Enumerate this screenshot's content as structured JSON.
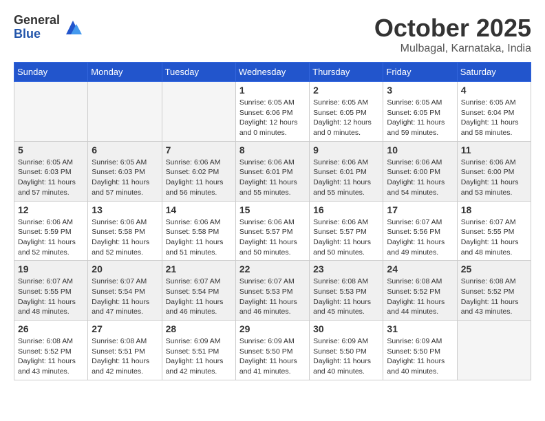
{
  "logo": {
    "general": "General",
    "blue": "Blue"
  },
  "header": {
    "month": "October 2025",
    "location": "Mulbagal, Karnataka, India"
  },
  "weekdays": [
    "Sunday",
    "Monday",
    "Tuesday",
    "Wednesday",
    "Thursday",
    "Friday",
    "Saturday"
  ],
  "weeks": [
    {
      "shaded": false,
      "days": [
        {
          "num": "",
          "empty": true
        },
        {
          "num": "",
          "empty": true
        },
        {
          "num": "",
          "empty": true
        },
        {
          "num": "1",
          "sunrise": "6:05 AM",
          "sunset": "6:06 PM",
          "daylight": "12 hours and 0 minutes."
        },
        {
          "num": "2",
          "sunrise": "6:05 AM",
          "sunset": "6:05 PM",
          "daylight": "12 hours and 0 minutes."
        },
        {
          "num": "3",
          "sunrise": "6:05 AM",
          "sunset": "6:05 PM",
          "daylight": "11 hours and 59 minutes."
        },
        {
          "num": "4",
          "sunrise": "6:05 AM",
          "sunset": "6:04 PM",
          "daylight": "11 hours and 58 minutes."
        }
      ]
    },
    {
      "shaded": true,
      "days": [
        {
          "num": "5",
          "sunrise": "6:05 AM",
          "sunset": "6:03 PM",
          "daylight": "11 hours and 57 minutes."
        },
        {
          "num": "6",
          "sunrise": "6:05 AM",
          "sunset": "6:03 PM",
          "daylight": "11 hours and 57 minutes."
        },
        {
          "num": "7",
          "sunrise": "6:06 AM",
          "sunset": "6:02 PM",
          "daylight": "11 hours and 56 minutes."
        },
        {
          "num": "8",
          "sunrise": "6:06 AM",
          "sunset": "6:01 PM",
          "daylight": "11 hours and 55 minutes."
        },
        {
          "num": "9",
          "sunrise": "6:06 AM",
          "sunset": "6:01 PM",
          "daylight": "11 hours and 55 minutes."
        },
        {
          "num": "10",
          "sunrise": "6:06 AM",
          "sunset": "6:00 PM",
          "daylight": "11 hours and 54 minutes."
        },
        {
          "num": "11",
          "sunrise": "6:06 AM",
          "sunset": "6:00 PM",
          "daylight": "11 hours and 53 minutes."
        }
      ]
    },
    {
      "shaded": false,
      "days": [
        {
          "num": "12",
          "sunrise": "6:06 AM",
          "sunset": "5:59 PM",
          "daylight": "11 hours and 52 minutes."
        },
        {
          "num": "13",
          "sunrise": "6:06 AM",
          "sunset": "5:58 PM",
          "daylight": "11 hours and 52 minutes."
        },
        {
          "num": "14",
          "sunrise": "6:06 AM",
          "sunset": "5:58 PM",
          "daylight": "11 hours and 51 minutes."
        },
        {
          "num": "15",
          "sunrise": "6:06 AM",
          "sunset": "5:57 PM",
          "daylight": "11 hours and 50 minutes."
        },
        {
          "num": "16",
          "sunrise": "6:06 AM",
          "sunset": "5:57 PM",
          "daylight": "11 hours and 50 minutes."
        },
        {
          "num": "17",
          "sunrise": "6:07 AM",
          "sunset": "5:56 PM",
          "daylight": "11 hours and 49 minutes."
        },
        {
          "num": "18",
          "sunrise": "6:07 AM",
          "sunset": "5:55 PM",
          "daylight": "11 hours and 48 minutes."
        }
      ]
    },
    {
      "shaded": true,
      "days": [
        {
          "num": "19",
          "sunrise": "6:07 AM",
          "sunset": "5:55 PM",
          "daylight": "11 hours and 48 minutes."
        },
        {
          "num": "20",
          "sunrise": "6:07 AM",
          "sunset": "5:54 PM",
          "daylight": "11 hours and 47 minutes."
        },
        {
          "num": "21",
          "sunrise": "6:07 AM",
          "sunset": "5:54 PM",
          "daylight": "11 hours and 46 minutes."
        },
        {
          "num": "22",
          "sunrise": "6:07 AM",
          "sunset": "5:53 PM",
          "daylight": "11 hours and 46 minutes."
        },
        {
          "num": "23",
          "sunrise": "6:08 AM",
          "sunset": "5:53 PM",
          "daylight": "11 hours and 45 minutes."
        },
        {
          "num": "24",
          "sunrise": "6:08 AM",
          "sunset": "5:52 PM",
          "daylight": "11 hours and 44 minutes."
        },
        {
          "num": "25",
          "sunrise": "6:08 AM",
          "sunset": "5:52 PM",
          "daylight": "11 hours and 43 minutes."
        }
      ]
    },
    {
      "shaded": false,
      "days": [
        {
          "num": "26",
          "sunrise": "6:08 AM",
          "sunset": "5:52 PM",
          "daylight": "11 hours and 43 minutes."
        },
        {
          "num": "27",
          "sunrise": "6:08 AM",
          "sunset": "5:51 PM",
          "daylight": "11 hours and 42 minutes."
        },
        {
          "num": "28",
          "sunrise": "6:09 AM",
          "sunset": "5:51 PM",
          "daylight": "11 hours and 42 minutes."
        },
        {
          "num": "29",
          "sunrise": "6:09 AM",
          "sunset": "5:50 PM",
          "daylight": "11 hours and 41 minutes."
        },
        {
          "num": "30",
          "sunrise": "6:09 AM",
          "sunset": "5:50 PM",
          "daylight": "11 hours and 40 minutes."
        },
        {
          "num": "31",
          "sunrise": "6:09 AM",
          "sunset": "5:50 PM",
          "daylight": "11 hours and 40 minutes."
        },
        {
          "num": "",
          "empty": true
        }
      ]
    }
  ]
}
